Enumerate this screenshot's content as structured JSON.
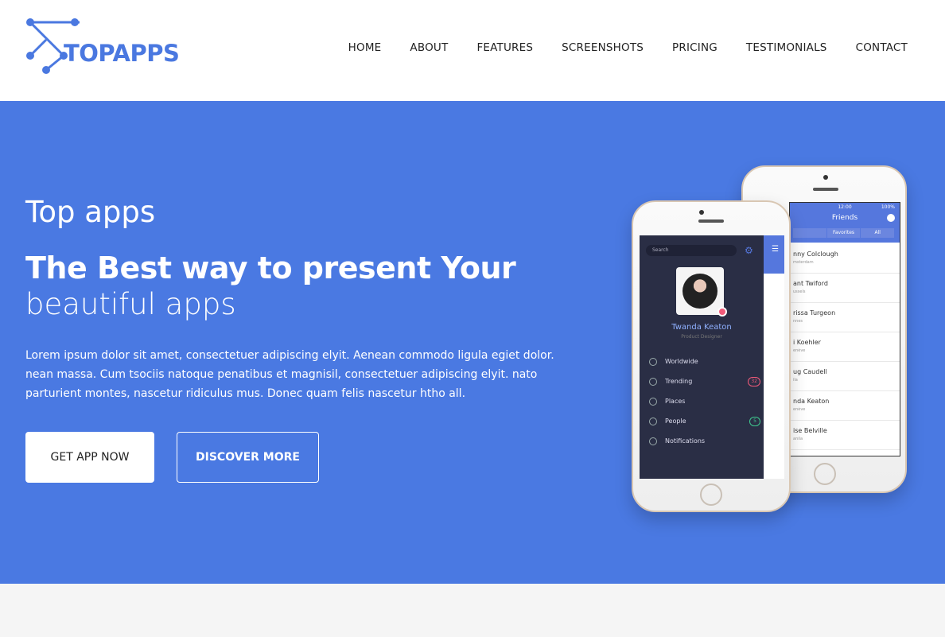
{
  "brand": {
    "name": "TOPAPPS",
    "accent": "#4a78e0",
    "hero_bg": "#4a79e2"
  },
  "nav": {
    "items": [
      "HOME",
      "ABOUT",
      "FEATURES",
      "SCREENSHOTS",
      "PRICING",
      "TESTIMONIALS",
      "CONTACT"
    ]
  },
  "hero": {
    "subtitle": "Top apps",
    "title_bold": "The Best way to present Your",
    "title_light": "beautiful apps",
    "description": "Lorem ipsum dolor sit amet, consectetuer adipiscing elyit. Aenean commodo ligula egiet dolor. nean massa. Cum tsociis natoque penatibus et magnisil, consectetuer adipiscing elyit. nato parturient montes, nascetur ridiculus mus. Donec quam felis nascetur htho all.",
    "primary_button": "GET APP NOW",
    "secondary_button": "DISCOVER MORE"
  },
  "phone_back": {
    "time": "12:00",
    "battery": "100%",
    "title": "Friends",
    "segments": [
      "",
      "Favorites",
      "All"
    ],
    "friends": [
      {
        "name": "nny Colclough",
        "city": "msterdam"
      },
      {
        "name": "ant Twiford",
        "city": "ussels"
      },
      {
        "name": "rissa Turgeon",
        "city": "nnes"
      },
      {
        "name": "i Koehler",
        "city": "enève"
      },
      {
        "name": "ug Caudell",
        "city": "ila"
      },
      {
        "name": "nda Keaton",
        "city": "enève"
      },
      {
        "name": "ise Belville",
        "city": "anila"
      }
    ]
  },
  "phone_front": {
    "search_placeholder": "Search",
    "user_name": "Twanda Keaton",
    "user_role": "Product Designer",
    "menu": [
      {
        "label": "Worldwide",
        "badge": ""
      },
      {
        "label": "Trending",
        "badge": "32"
      },
      {
        "label": "Places",
        "badge": ""
      },
      {
        "label": "People",
        "badge": "5"
      },
      {
        "label": "Notifications",
        "badge": ""
      }
    ]
  }
}
